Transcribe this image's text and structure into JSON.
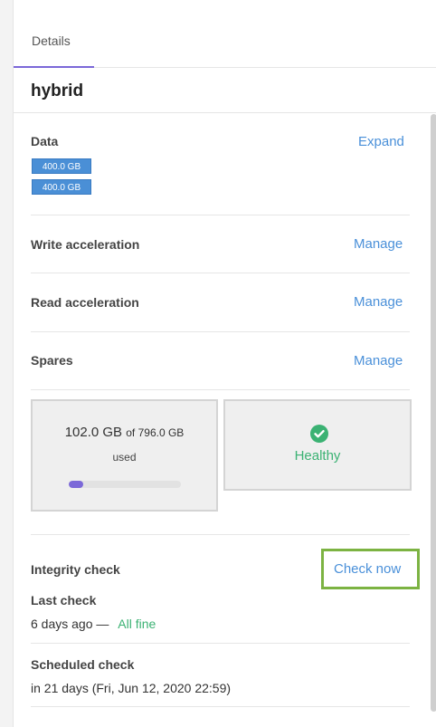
{
  "tabs": [
    {
      "label": "Details"
    }
  ],
  "pool": {
    "name": "hybrid"
  },
  "data_section": {
    "label": "Data",
    "action": "Expand",
    "chips": [
      "400.0 GB",
      "400.0 GB"
    ]
  },
  "write_acceleration": {
    "label": "Write acceleration",
    "action": "Manage"
  },
  "read_acceleration": {
    "label": "Read acceleration",
    "action": "Manage"
  },
  "spares": {
    "label": "Spares",
    "action": "Manage"
  },
  "usage": {
    "used": "102.0 GB",
    "of_text": "of 796.0 GB",
    "used_label": "used",
    "used_fraction": 0.128
  },
  "health": {
    "label": "Healthy",
    "color": "#3bb273",
    "icon": "check-circle-icon"
  },
  "integrity": {
    "label": "Integrity check",
    "action": "Check now",
    "last_check_label": "Last check",
    "last_check_value": "6 days ago —",
    "last_check_status": "All fine",
    "scheduled_label": "Scheduled check",
    "scheduled_value": "in 21 days (Fri, Jun 12, 2020 22:59)"
  },
  "colors": {
    "link": "#4a90d9",
    "accent": "#7b68d8",
    "highlight": "#7cb342",
    "chip": "#4a8fd6"
  }
}
